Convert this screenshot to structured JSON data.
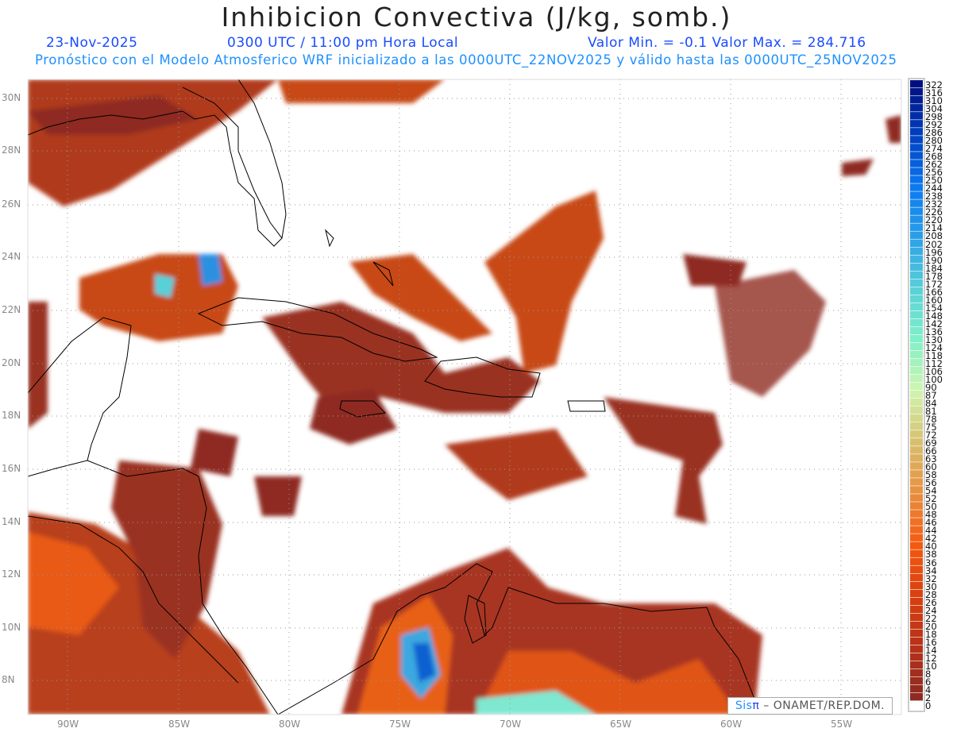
{
  "header": {
    "title": "Inhibicion Convectiva (J/kg, somb.)",
    "date": "23-Nov-2025",
    "time": "0300 UTC / 11:00 pm Hora Local",
    "minmax": "Valor Min. = -0.1  Valor Max. = 284.716",
    "subtitle": "Pronóstico con el Modelo Atmosferico WRF inicializado a las 0000UTC_22NOV2025 y válido hasta las  0000UTC_25NOV2025"
  },
  "axes": {
    "lat_labels": [
      "30N",
      "28N",
      "26N",
      "24N",
      "22N",
      "20N",
      "18N",
      "16N",
      "14N",
      "12N",
      "10N",
      "8N"
    ],
    "lon_labels": [
      "90W",
      "85W",
      "80W",
      "75W",
      "70W",
      "65W",
      "60W",
      "55W"
    ]
  },
  "colorbar": {
    "levels": [
      "322",
      "316",
      "310",
      "304",
      "298",
      "292",
      "286",
      "280",
      "274",
      "268",
      "262",
      "256",
      "250",
      "244",
      "238",
      "232",
      "226",
      "220",
      "214",
      "208",
      "202",
      "196",
      "190",
      "184",
      "178",
      "172",
      "166",
      "160",
      "154",
      "148",
      "142",
      "136",
      "130",
      "124",
      "118",
      "112",
      "106",
      "100",
      "90",
      "87",
      "84",
      "81",
      "78",
      "75",
      "72",
      "69",
      "66",
      "63",
      "60",
      "58",
      "56",
      "54",
      "52",
      "50",
      "48",
      "46",
      "44",
      "42",
      "40",
      "38",
      "36",
      "34",
      "32",
      "30",
      "28",
      "26",
      "24",
      "22",
      "20",
      "18",
      "16",
      "14",
      "12",
      "10",
      "8",
      "6",
      "4",
      "2",
      "0"
    ],
    "palette": [
      "#000f80",
      "#0040c0",
      "#0a78f0",
      "#2aa0e8",
      "#58d0d8",
      "#80f0c8",
      "#cff5b0",
      "#d8c070",
      "#e89040",
      "#f55a10",
      "#d84010",
      "#b83218",
      "#8e2a22",
      "#ffffff"
    ]
  },
  "credit": {
    "sis": "Sis",
    "pi": "π",
    "rest": " – ONAMET/REP.DOM."
  }
}
